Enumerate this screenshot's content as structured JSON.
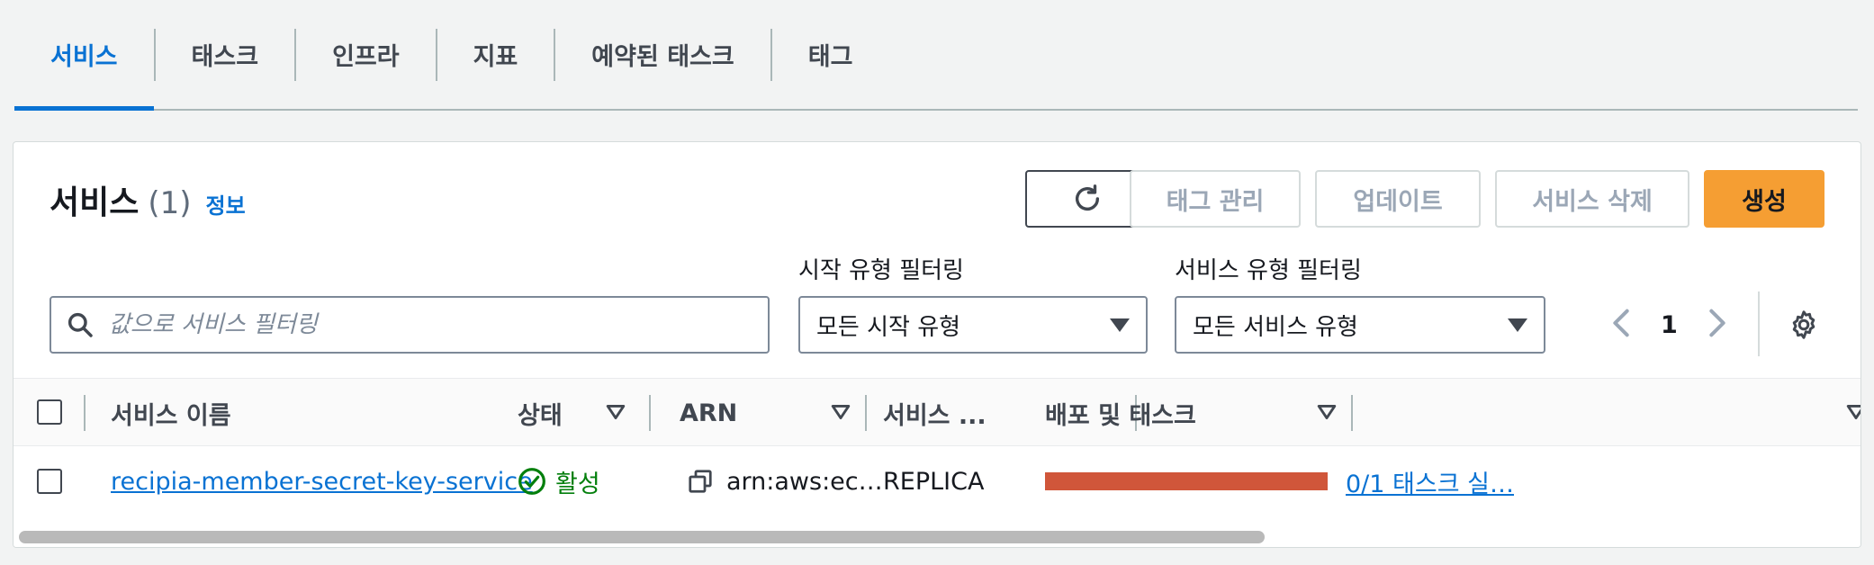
{
  "tabs": [
    {
      "label": "서비스",
      "active": true
    },
    {
      "label": "태스크"
    },
    {
      "label": "인프라"
    },
    {
      "label": "지표"
    },
    {
      "label": "예약된 태스크"
    },
    {
      "label": "태그"
    }
  ],
  "panel": {
    "title": "서비스",
    "count": "(1)",
    "info_link": "정보"
  },
  "toolbar": {
    "refresh_icon": "refresh-icon",
    "manage_tags_label": "태그 관리",
    "update_label": "업데이트",
    "delete_label": "서비스 삭제",
    "create_label": "생성"
  },
  "filters": {
    "search_placeholder": "값으로 서비스 필터링",
    "launch_type_label": "시작 유형 필터링",
    "launch_type_value": "모든 시작 유형",
    "service_type_label": "서비스 유형 필터링",
    "service_type_value": "모든 서비스 유형"
  },
  "pagination": {
    "current_page": "1"
  },
  "table": {
    "columns": [
      "서비스 이름",
      "상태",
      "ARN",
      "서비스 ...",
      "배포 및 태스크"
    ],
    "rows": [
      {
        "name": "recipia-member-secret-key-service",
        "status": "활성",
        "arn": "arn:aws:ec…",
        "service_type": "REPLICA",
        "tasks": "0/1 태스크 실…"
      }
    ]
  },
  "colors": {
    "accent": "#0972d3",
    "primary_button": "#f59e33",
    "status_active": "#037f0c",
    "task_bar": "#d0563a"
  }
}
